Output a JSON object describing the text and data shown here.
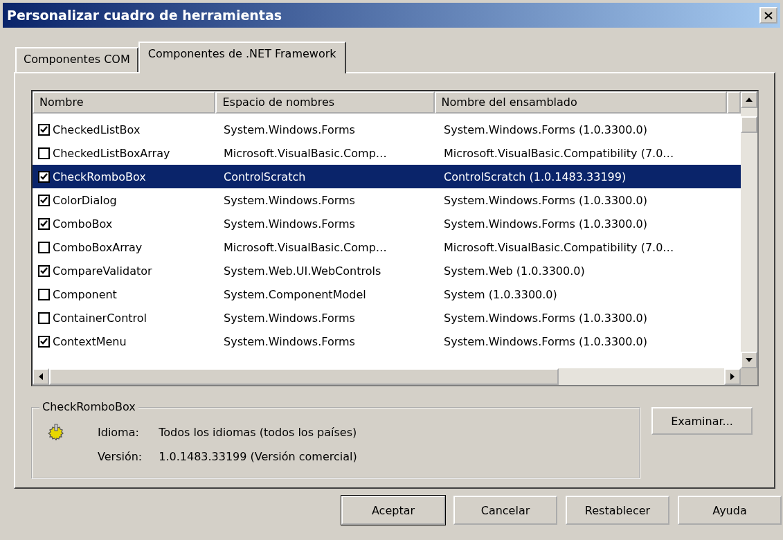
{
  "window": {
    "title": "Personalizar cuadro de herramientas"
  },
  "tabs": [
    {
      "label": "Componentes COM",
      "selected": false
    },
    {
      "label": "Componentes de .NET Framework",
      "selected": true
    }
  ],
  "table": {
    "columns": [
      "Nombre",
      "Espacio de nombres",
      "Nombre del ensamblado"
    ],
    "rows": [
      {
        "checked": true,
        "selected": false,
        "cells": [
          "CheckedListBox",
          "System.Windows.Forms",
          "System.Windows.Forms (1.0.3300.0)"
        ]
      },
      {
        "checked": false,
        "selected": false,
        "cells": [
          "CheckedListBoxArray",
          "Microsoft.VisualBasic.Comp…",
          "Microsoft.VisualBasic.Compatibility (7.0…"
        ]
      },
      {
        "checked": true,
        "selected": true,
        "cells": [
          "CheckRomboBox",
          "ControlScratch",
          "ControlScratch (1.0.1483.33199)"
        ]
      },
      {
        "checked": true,
        "selected": false,
        "cells": [
          "ColorDialog",
          "System.Windows.Forms",
          "System.Windows.Forms (1.0.3300.0)"
        ]
      },
      {
        "checked": true,
        "selected": false,
        "cells": [
          "ComboBox",
          "System.Windows.Forms",
          "System.Windows.Forms (1.0.3300.0)"
        ]
      },
      {
        "checked": false,
        "selected": false,
        "cells": [
          "ComboBoxArray",
          "Microsoft.VisualBasic.Comp…",
          "Microsoft.VisualBasic.Compatibility (7.0…"
        ]
      },
      {
        "checked": true,
        "selected": false,
        "cells": [
          "CompareValidator",
          "System.Web.UI.WebControls",
          "System.Web (1.0.3300.0)"
        ]
      },
      {
        "checked": false,
        "selected": false,
        "cells": [
          "Component",
          "System.ComponentModel",
          "System (1.0.3300.0)"
        ]
      },
      {
        "checked": false,
        "selected": false,
        "cells": [
          "ContainerControl",
          "System.Windows.Forms",
          "System.Windows.Forms (1.0.3300.0)"
        ]
      },
      {
        "checked": true,
        "selected": false,
        "cells": [
          "ContextMenu",
          "System.Windows.Forms",
          "System.Windows.Forms (1.0.3300.0)"
        ]
      }
    ]
  },
  "details": {
    "title": "CheckRomboBox",
    "fields": [
      {
        "label": "Idioma:",
        "value": "Todos los idiomas (todos los países)"
      },
      {
        "label": "Versión:",
        "value": "1.0.1483.33199 (Versión comercial)"
      }
    ]
  },
  "browse_button": "Examinar...",
  "buttons": [
    {
      "label": "Aceptar",
      "default": true
    },
    {
      "label": "Cancelar",
      "default": false
    },
    {
      "label": "Restablecer",
      "default": false
    },
    {
      "label": "Ayuda",
      "default": false
    }
  ]
}
